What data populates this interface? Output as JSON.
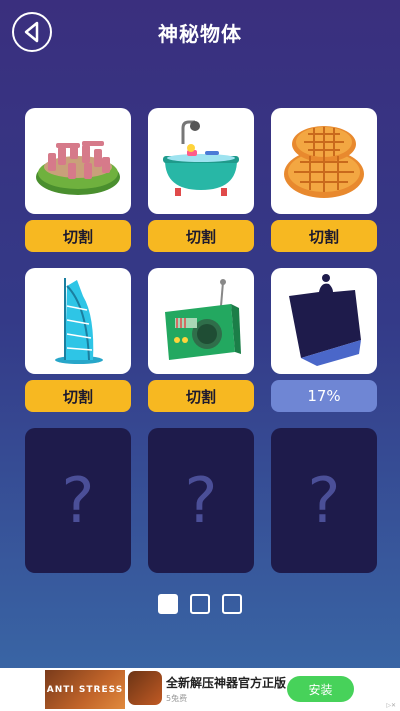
{
  "header": {
    "title": "神秘物体",
    "back_icon": "back-arrow-icon"
  },
  "items": [
    {
      "name": "stonehenge",
      "action_label": "切割"
    },
    {
      "name": "bathtub",
      "action_label": "切割"
    },
    {
      "name": "waffles",
      "action_label": "切割"
    },
    {
      "name": "burj-al-arab",
      "action_label": "切割"
    },
    {
      "name": "radio",
      "action_label": "切割"
    },
    {
      "name": "mystery-object",
      "action_label": "17%",
      "progress": 0.17
    }
  ],
  "locked": [
    {
      "symbol": "?"
    },
    {
      "symbol": "?"
    },
    {
      "symbol": "?"
    }
  ],
  "pager": {
    "pages": 3,
    "current": 1
  },
  "ad": {
    "image_text": "ANTI STRESS",
    "title": "全新解压神器官方正版",
    "subtitle": "5兔费",
    "install_label": "安装"
  },
  "colors": {
    "action": "#f7b821",
    "progress": "#6f86d4",
    "locked_card": "#1e1b4b",
    "install": "#47d25a"
  }
}
